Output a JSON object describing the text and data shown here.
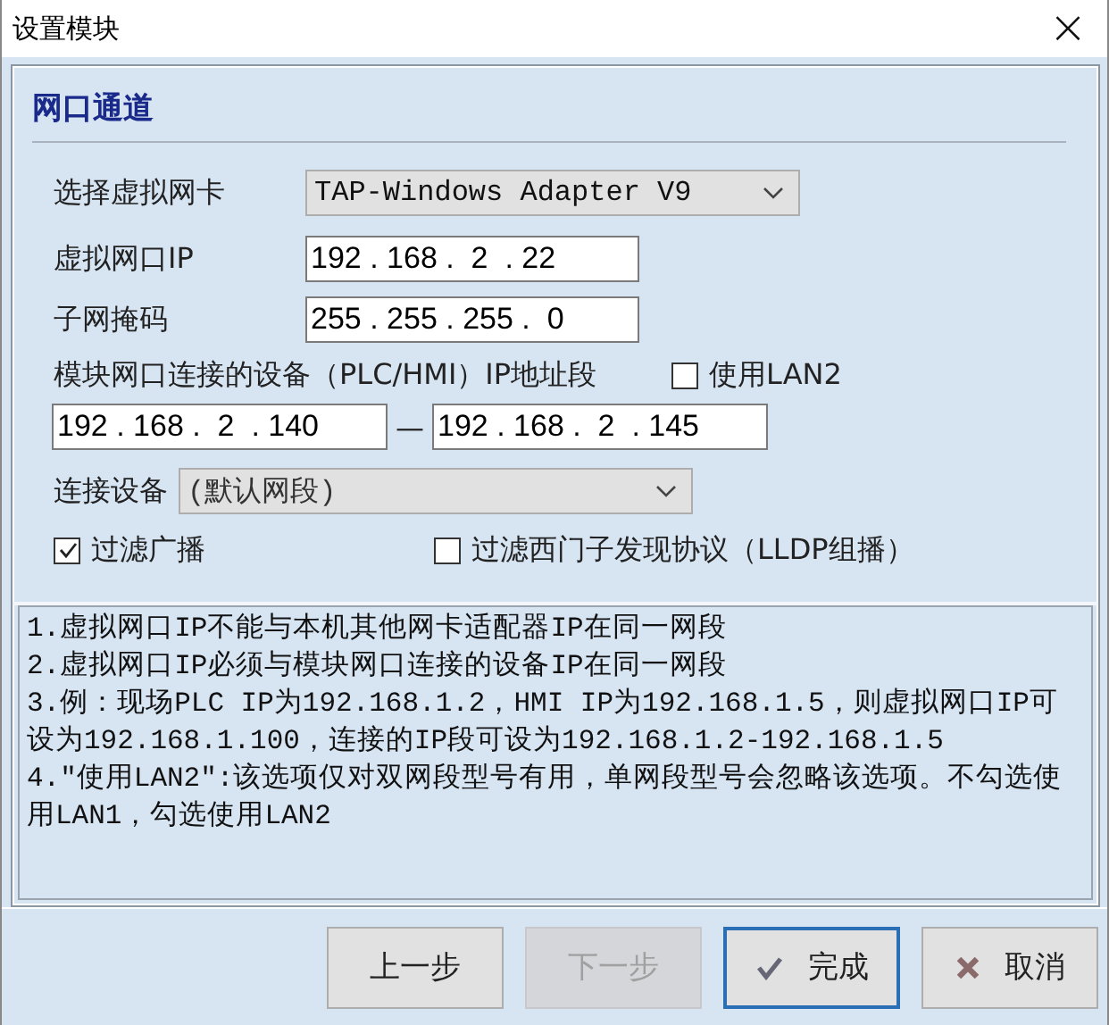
{
  "window": {
    "title": "设置模块",
    "close": "×"
  },
  "section": {
    "title": "网口通道"
  },
  "form": {
    "adapter": {
      "label": "选择虚拟网卡",
      "value": "TAP-Windows Adapter V9"
    },
    "virtual_ip": {
      "label": "虚拟网口IP",
      "value": "192 . 168 .  2  . 22"
    },
    "subnet": {
      "label": "子网掩码",
      "value": "255 . 255 . 255 .  0"
    },
    "range": {
      "label": "模块网口连接的设备（PLC/HMI）IP地址段",
      "start": "192 . 168 .  2  . 140",
      "separator": "—",
      "end": "192 . 168 .  2  . 145"
    },
    "use_lan2": {
      "label": "使用LAN2",
      "checked": false
    },
    "device": {
      "label": "连接设备",
      "value": "(默认网段)"
    },
    "filter_broadcast": {
      "label": "过滤广播",
      "checked": true
    },
    "filter_lldp": {
      "label": "过滤西门子发现协议（LLDP组播）",
      "checked": false
    }
  },
  "notes": [
    "1.虚拟网口IP不能与本机其他网卡适配器IP在同一网段",
    "2.虚拟网口IP必须与模块网口连接的设备IP在同一网段",
    "3.例：现场PLC IP为192.168.1.2，HMI IP为192.168.1.5，则虚拟网口IP可设为192.168.1.100，连接的IP段可设为192.168.1.2-192.168.1.5",
    "4.\"使用LAN2\":该选项仅对双网段型号有用，单网段型号会忽略该选项。不勾选使用LAN1，勾选使用LAN2"
  ],
  "buttons": [
    {
      "kind": "plain",
      "label": "上一步",
      "disabled": false,
      "focused": false
    },
    {
      "kind": "plain",
      "label": "下一步",
      "disabled": true,
      "focused": false
    },
    {
      "kind": "ok",
      "label": "完成",
      "disabled": false,
      "focused": true
    },
    {
      "kind": "cancel",
      "label": "取消",
      "disabled": false,
      "focused": false
    }
  ]
}
